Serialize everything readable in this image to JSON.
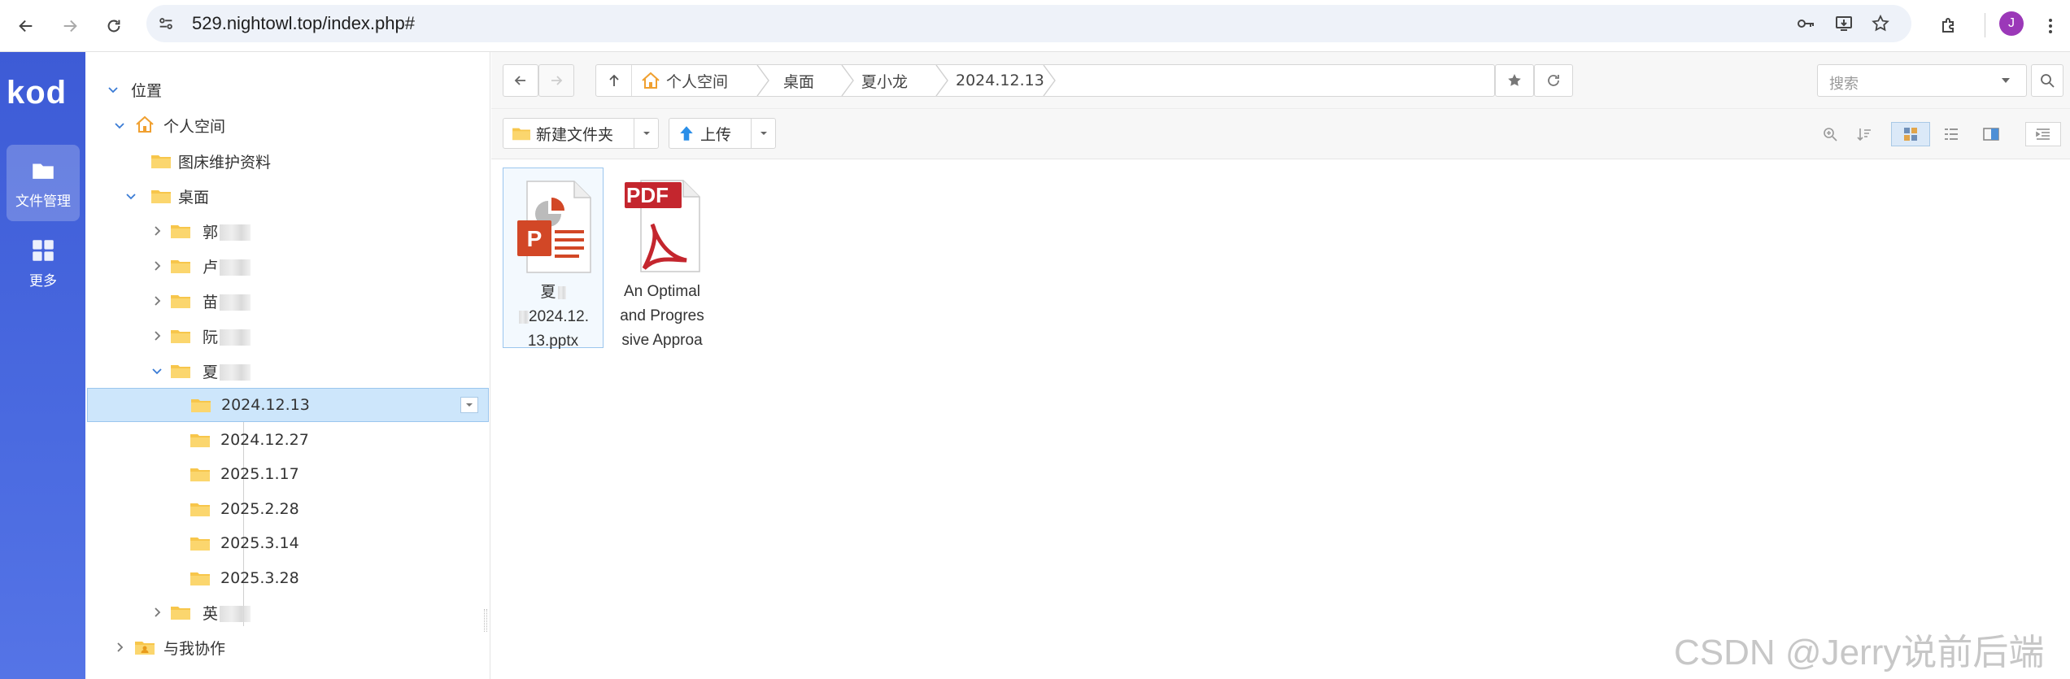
{
  "browser": {
    "url": "529.nightowl.top/index.php#",
    "profile_initial": "J",
    "profile_color": "#9b38b8"
  },
  "appnav": {
    "logo": "kod",
    "items": [
      {
        "label": "文件管理",
        "icon": "folder-icon",
        "active": true
      },
      {
        "label": "更多",
        "icon": "grid-icon",
        "active": false
      }
    ]
  },
  "tree": {
    "root": "位置",
    "personal": "个人空间",
    "tuchuang": "图床维护资料",
    "desktop": "桌面",
    "subfolders": [
      {
        "label": "郭"
      },
      {
        "label": "卢"
      },
      {
        "label": "苗"
      },
      {
        "label": "阮"
      },
      {
        "label": "夏"
      }
    ],
    "xia_children": [
      "2024.12.13",
      "2024.12.27",
      "2025.1.17",
      "2025.2.28",
      "2025.3.14",
      "2025.3.28"
    ],
    "after": {
      "label": "英"
    },
    "collab": "与我协作"
  },
  "breadcrumb": [
    "个人空间",
    "桌面",
    "夏小龙",
    "2024.12.13"
  ],
  "search": {
    "placeholder": "搜索"
  },
  "toolbar": {
    "new_folder": "新建文件夹",
    "upload": "上传"
  },
  "files": [
    {
      "type": "pptx",
      "name_line1": "夏",
      "name_line2": "2024.12.",
      "name_line3": "13.pptx"
    },
    {
      "type": "pdf",
      "badge": "PDF",
      "name_line1": "An Optimal",
      "name_line2": "and Progres",
      "name_line3": "sive Approa"
    }
  ],
  "watermark": "CSDN @Jerry说前后端",
  "colors": {
    "accent": "#3d5bd6",
    "selection": "#cde6fb",
    "folder": "#f7c64b",
    "ppt": "#d24726",
    "pdf": "#c4262e"
  }
}
